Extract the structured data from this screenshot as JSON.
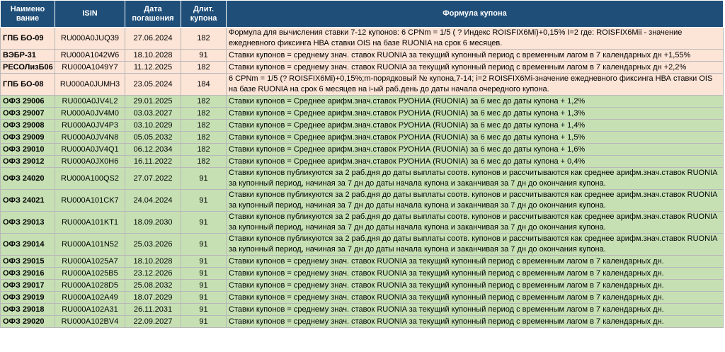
{
  "headers": {
    "name": "Наимено\nвание",
    "isin": "ISIN",
    "maturity": "Дата\nпогашения",
    "coupon_len": "Длит.\nкупона",
    "formula": "Формула купона"
  },
  "colors": {
    "header_bg": "#1f4e78",
    "pink_row": "#fce4d6",
    "green_row": "#c6e0b4"
  },
  "rows": [
    {
      "group": "pink",
      "name": "ГПБ БО-09",
      "isin": "RU000A0JUQ39",
      "date": "27.06.2024",
      "len": "182",
      "formula": "Формула для вычисления ставки 7-12 купонов: 6 CPNm = 1/5 ( ? Индекс ROISFIX6Mi)+0,15% I=2 где: ROISFIX6Mii - значение ежедневного фиксинга НВА ставки OIS на базе RUONIA на срок 6 месяцев."
    },
    {
      "group": "pink",
      "name": "ВЭБР-31",
      "isin": "RU000A1042W6",
      "date": "18.10.2028",
      "len": "91",
      "formula": "Ставки купонов = среднему знач. ставок RUONIA за текущий купонный период с временным лагом в 7 календарных дн +1,55%"
    },
    {
      "group": "pink",
      "name": "РЕСОЛизБ06",
      "isin": "RU000A1049Y7",
      "date": "11.12.2025",
      "len": "182",
      "formula": "Ставки купонов = среднему знач. ставок RUONIA за текущий купонный период с временным лагом в 7 календарных дн +2,2%"
    },
    {
      "group": "pink",
      "name": "ГПБ БО-08",
      "isin": "RU000A0JUMH3",
      "date": "23.05.2024",
      "len": "184",
      "formula": "6 CPNm = 1/5 (? ROISFIX6Mi)+0,15%;m-порядковый № купона,7-14; i=2 ROISFIX6Mi-значение ежедневного фиксинга НВА ставки OIS на базе RUONIA на срок 6 месяцев на i-ый раб.день до даты начала очередного купона."
    },
    {
      "group": "green",
      "name": "ОФЗ 29006",
      "isin": "RU000A0JV4L2",
      "date": "29.01.2025",
      "len": "182",
      "formula": "Ставки купонов = Среднее арифм.знач.ставок РУОНИА (RUONIA) за 6 мес до даты купона + 1,2%"
    },
    {
      "group": "green",
      "name": "ОФЗ 29007",
      "isin": "RU000A0JV4M0",
      "date": "03.03.2027",
      "len": "182",
      "formula": "Ставки купонов = Среднее арифм.знач.ставок РУОНИА (RUONIA) за 6 мес до даты купона + 1,3%"
    },
    {
      "group": "green",
      "name": "ОФЗ 29008",
      "isin": "RU000A0JV4P3",
      "date": "03.10.2029",
      "len": "182",
      "formula": "Ставки купонов = Среднее арифм.знач.ставок РУОНИА (RUONIA) за 6 мес до даты купона + 1,4%"
    },
    {
      "group": "green",
      "name": "ОФЗ 29009",
      "isin": "RU000A0JV4N8",
      "date": "05.05.2032",
      "len": "182",
      "formula": "Ставки купонов = Среднее арифм.знач.ставок РУОНИА (RUONIA) за 6 мес до даты купона + 1,5%"
    },
    {
      "group": "green",
      "name": "ОФЗ 29010",
      "isin": "RU000A0JV4Q1",
      "date": "06.12.2034",
      "len": "182",
      "formula": "Ставки купонов = Среднее арифм.знач.ставок РУОНИА (RUONIA) за 6 мес до даты купона + 1,6%"
    },
    {
      "group": "green",
      "name": "ОФЗ 29012",
      "isin": "RU000A0JX0H6",
      "date": "16.11.2022",
      "len": "182",
      "formula": "Ставки купонов = Среднее арифм.знач.ставок РУОНИА (RUONIA) за 6 мес до даты купона + 0,4%"
    },
    {
      "group": "green",
      "name": "ОФЗ 24020",
      "isin": "RU000A100QS2",
      "date": "27.07.2022",
      "len": "91",
      "formula": "Ставки купонов публикуются за 2 раб.дня до даты выплаты соотв. купонов и рассчитываются как среднее арифм.знач.ставок RUONIA за купонный период, начиная за 7 дн до даты начала купона и заканчивая за 7 дн до окончания купона."
    },
    {
      "group": "green",
      "name": "ОФЗ 24021",
      "isin": "RU000A101CK7",
      "date": "24.04.2024",
      "len": "91",
      "formula": "Ставки купонов публикуются за 2 раб.дня до даты выплаты соотв. купонов и рассчитываются как среднее арифм.знач.ставок RUONIA за купонный период, начиная за 7 дн до даты начала купона и заканчивая за 7 дн до окончания купона."
    },
    {
      "group": "green",
      "name": "ОФЗ 29013",
      "isin": "RU000A101KT1",
      "date": "18.09.2030",
      "len": "91",
      "formula": "Ставки купонов публикуются за 2 раб.дня до даты выплаты соотв. купонов и рассчитываются как среднее арифм.знач.ставок RUONIA за купонный период, начиная за 7 дн до даты начала купона и заканчивая за 7 дн до окончания купона."
    },
    {
      "group": "green",
      "name": "ОФЗ 29014",
      "isin": "RU000A101N52",
      "date": "25.03.2026",
      "len": "91",
      "formula": "Ставки купонов публикуются за 2 раб.дня до даты выплаты соотв. купонов и рассчитываются как среднее арифм.знач.ставок RUONIA за купонный период, начиная за 7 дн до даты начала купона и заканчивая за 7 дн до окончания купона."
    },
    {
      "group": "green",
      "name": "ОФЗ 29015",
      "isin": "RU000A1025A7",
      "date": "18.10.2028",
      "len": "91",
      "formula": "Ставки купонов = среднему знач. ставок RUONIA за текущий купонный период с временным лагом в 7 календарных дн."
    },
    {
      "group": "green",
      "name": "ОФЗ 29016",
      "isin": "RU000A1025B5",
      "date": "23.12.2026",
      "len": "91",
      "formula": "Ставки купонов = среднему знач. ставок RUONIA за текущий купонный период с временным лагом в 7 календарных дн."
    },
    {
      "group": "green",
      "name": "ОФЗ 29017",
      "isin": "RU000A1028D5",
      "date": "25.08.2032",
      "len": "91",
      "formula": "Ставки купонов = среднему знач. ставок RUONIA за текущий купонный период с временным лагом в 7 календарных дн."
    },
    {
      "group": "green",
      "name": "ОФЗ 29019",
      "isin": "RU000A102A49",
      "date": "18.07.2029",
      "len": "91",
      "formula": "Ставки купонов = среднему знач. ставок RUONIA за текущий купонный период с временным лагом в 7 календарных дн."
    },
    {
      "group": "green",
      "name": "ОФЗ 29018",
      "isin": "RU000A102A31",
      "date": "26.11.2031",
      "len": "91",
      "formula": "Ставки купонов = среднему знач. ставок RUONIA за текущий купонный период с временным лагом в 7 календарных дн."
    },
    {
      "group": "green",
      "name": "ОФЗ 29020",
      "isin": "RU000A102BV4",
      "date": "22.09.2027",
      "len": "91",
      "formula": "Ставки купонов = среднему знач. ставок RUONIA за текущий купонный период с временным лагом в 7 календарных дн."
    }
  ]
}
